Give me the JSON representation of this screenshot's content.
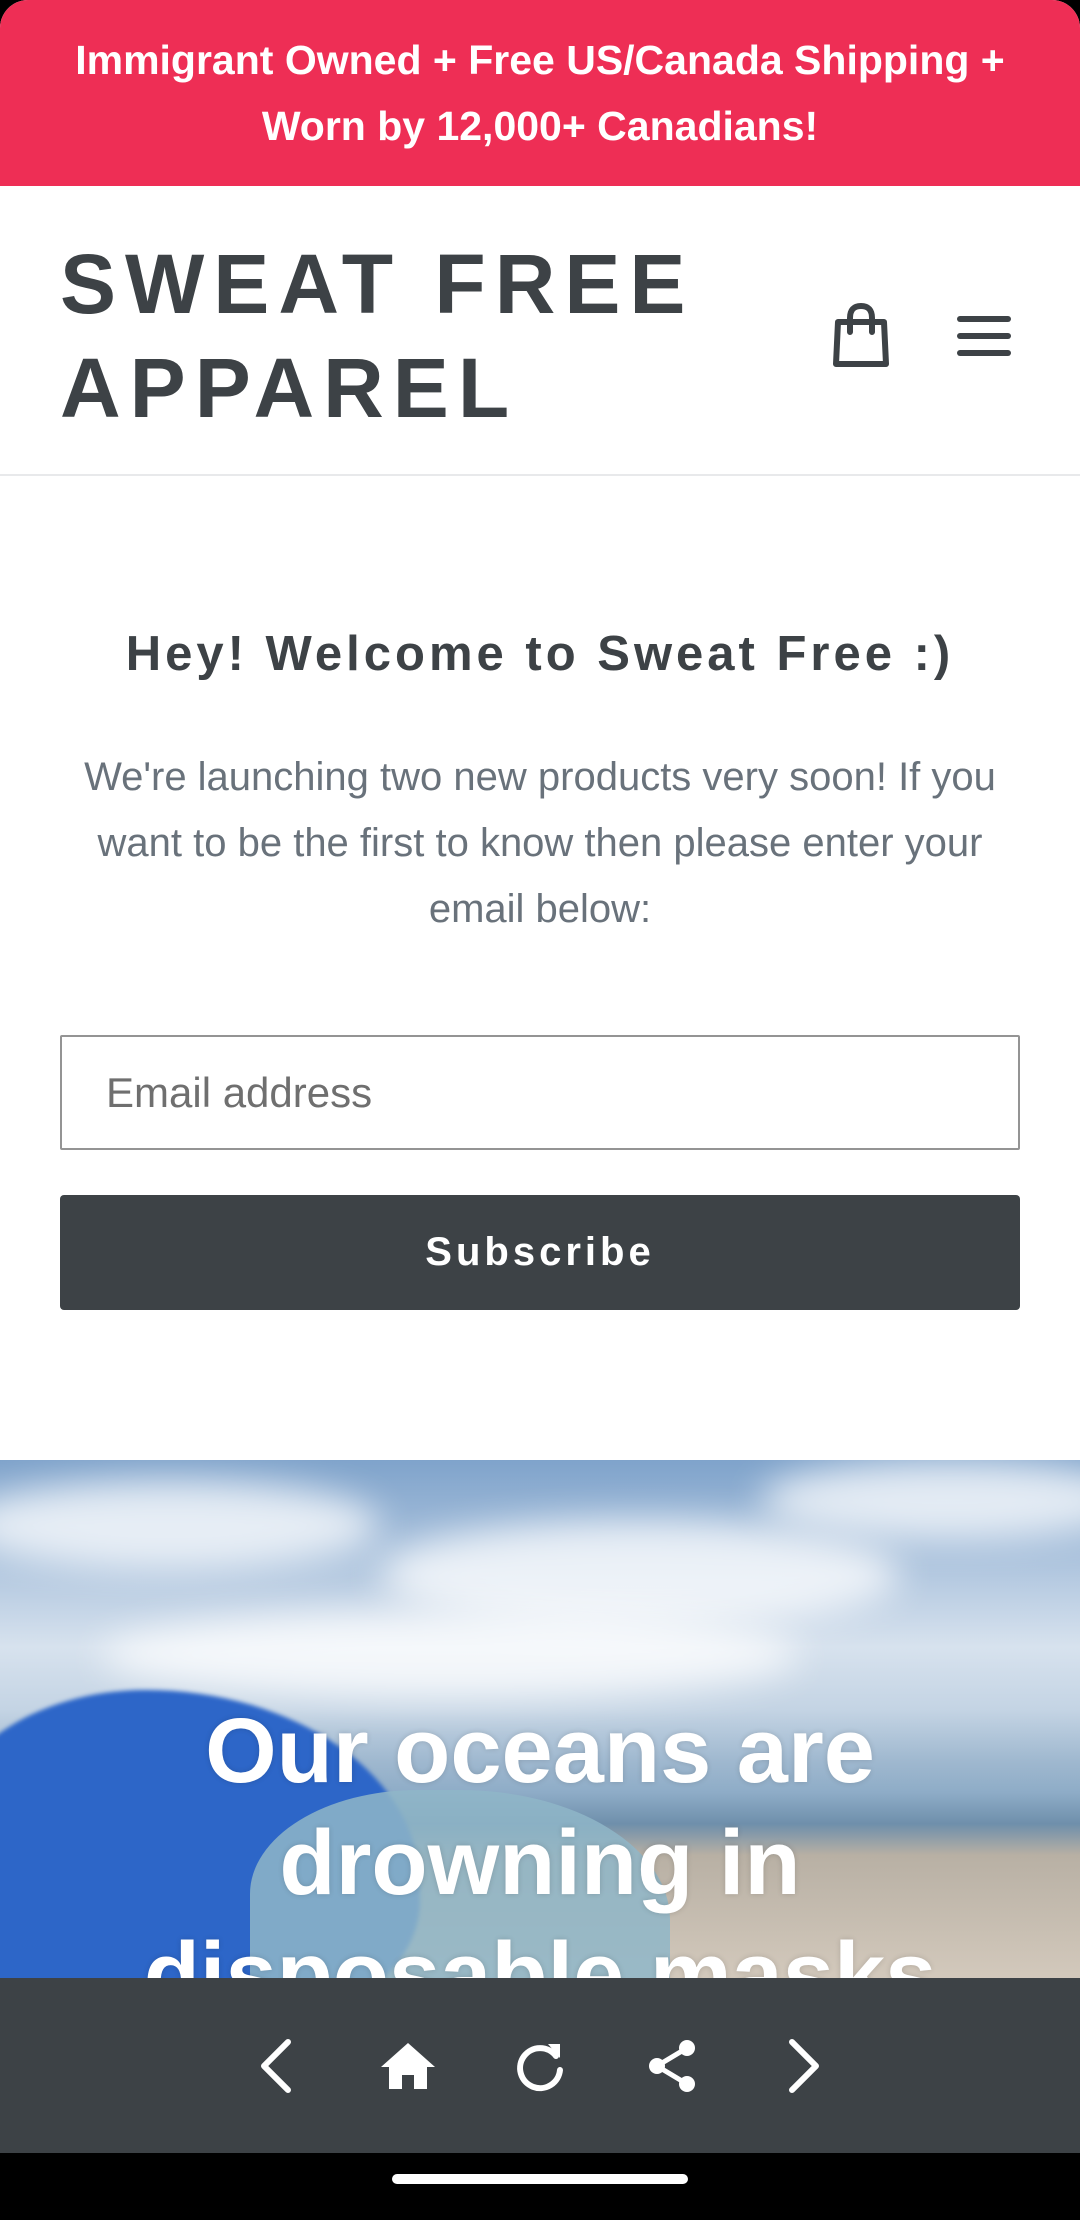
{
  "announcement": {
    "text": "Immigrant Owned + Free US/Canada Shipping + Worn by 12,000+ Canadians!"
  },
  "header": {
    "logo_line1": "SWEAT FREE",
    "logo_line2": "APPAREL",
    "cart_icon": "shopping-bag-icon",
    "menu_icon": "hamburger-menu-icon"
  },
  "newsletter": {
    "title": "Hey! Welcome to Sweat Free :)",
    "text": "We're launching two new products very soon! If you want to be the first to know then please enter your email below:",
    "email_placeholder": "Email address",
    "email_value": "",
    "subscribe_label": "Subscribe"
  },
  "hero": {
    "title": "Our oceans are drowning in disposable masks"
  },
  "bottom_bar": {
    "icons": [
      "chevron-left-icon",
      "home-icon",
      "refresh-icon",
      "share-icon",
      "chevron-right-icon"
    ]
  },
  "colors": {
    "announcement_bg": "#ee2e55",
    "primary_dark": "#3d4246",
    "text_muted": "#69727b"
  }
}
